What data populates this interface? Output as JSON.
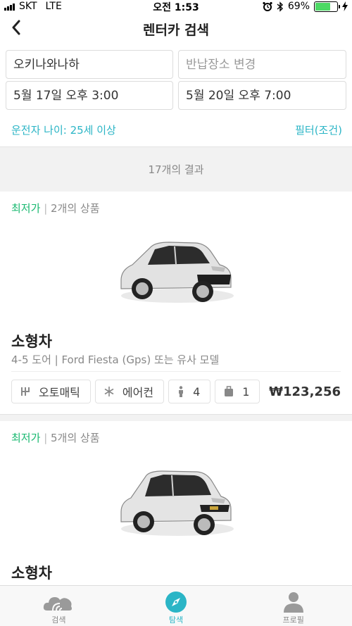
{
  "status_bar": {
    "carrier": "SKT",
    "network": "LTE",
    "time": "오전 1:53",
    "battery_percent": "69%",
    "battery_level": 0.69
  },
  "header": {
    "title": "렌터카 검색",
    "back_icon": "chevron-left-icon"
  },
  "search": {
    "pickup_location": "오키나와나하",
    "return_location_placeholder": "반납장소 변경",
    "pickup_datetime": "5월 17일 오후 3:00",
    "return_datetime": "5월 20일 오후 7:00",
    "driver_age": "운전자 나이: 25세 이상",
    "filter_label": "필터(조건)"
  },
  "results": {
    "count_label": "17개의 결과",
    "cards": [
      {
        "badge": "최저가",
        "offers": "2개의 상품",
        "car_type": "소형차",
        "description": "4-5 도어 | Ford Fiesta (Gps) 또는 유사 모델",
        "transmission": "오토매틱",
        "aircon": "에어컨",
        "seats": "4",
        "luggage": "1",
        "price": "₩123,256"
      },
      {
        "badge": "최저가",
        "offers": "5개의 상품",
        "car_type": "소형차"
      }
    ]
  },
  "tabbar": {
    "items": [
      {
        "label": "검색",
        "icon": "cloud-icon"
      },
      {
        "label": "탐색",
        "icon": "compass-icon"
      },
      {
        "label": "프로필",
        "icon": "person-icon"
      }
    ],
    "active_index": 1
  },
  "colors": {
    "accent": "#2bb5c6",
    "lowest_price": "#17b86f",
    "battery": "#4cd964"
  }
}
